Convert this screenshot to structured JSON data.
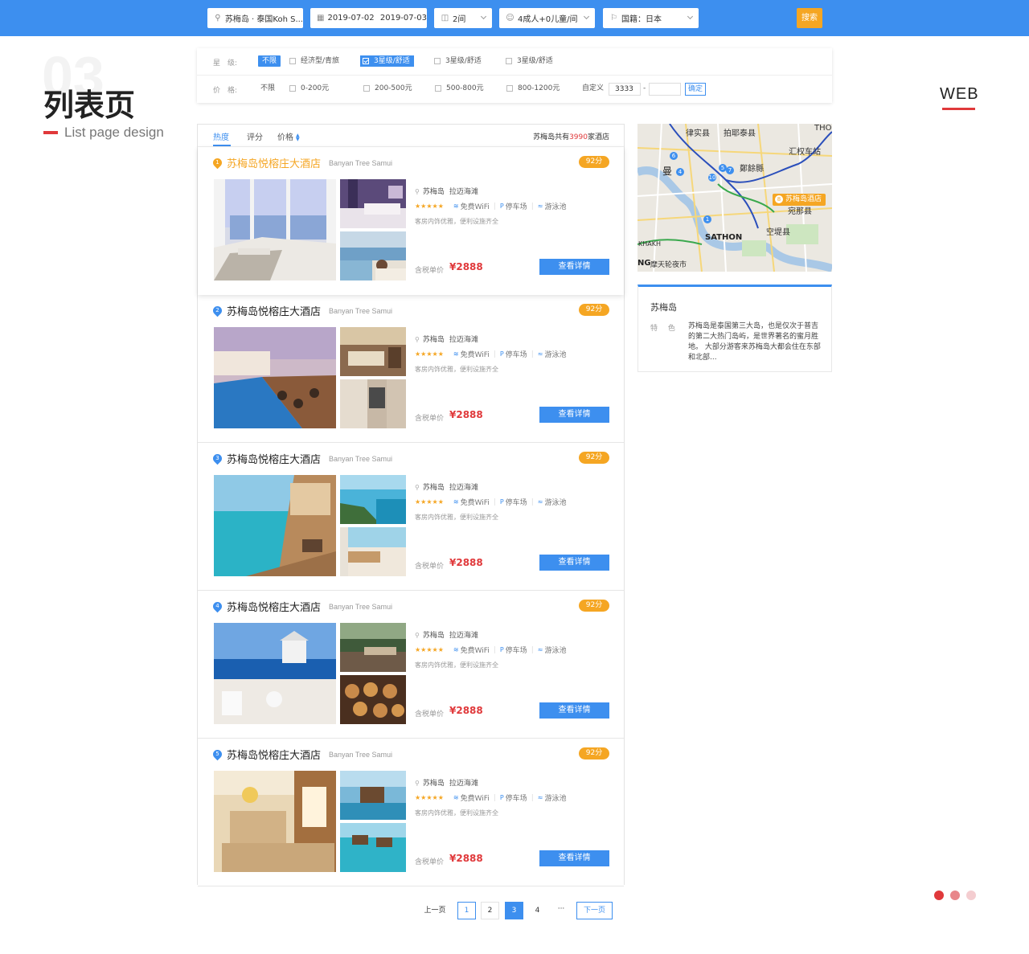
{
  "search": {
    "destination": "苏梅岛 · 泰国Koh S...",
    "checkin": "2019-07-02",
    "checkout": "2019-07-03",
    "rooms": "2间",
    "guests": "4成人+0儿童/间",
    "nationality": "国籍：日本",
    "search_label": "搜索"
  },
  "heading": {
    "number": "03",
    "title": "列表页",
    "subtitle": "List page design",
    "web": "WEB"
  },
  "filters": {
    "star_label": "星　级:",
    "star_options": [
      "不限",
      "经济型/青旅",
      "3星级/舒适",
      "3星级/舒适",
      "3星级/舒适"
    ],
    "price_label": "价　格:",
    "price_options": [
      "不限",
      "0-200元",
      "200-500元",
      "500-800元",
      "800-1200元"
    ],
    "custom_label": "自定义",
    "custom_min": "3333",
    "custom_dash": "-",
    "confirm_label": "确定"
  },
  "sort": {
    "tabs": [
      "热度",
      "评分",
      "价格"
    ],
    "active": 0,
    "total_prefix": "苏梅岛共有",
    "total_count": "3990",
    "total_suffix": "家酒店"
  },
  "hotels": [
    {
      "rank": "1",
      "name": "苏梅岛悦榕庄大酒店",
      "name_en": "Banyan Tree Samui",
      "score": "92分",
      "location": "苏梅岛",
      "area": "拉迈海滩",
      "stars": "★★★★★",
      "wifi": "免费WiFi",
      "parking": "停车场",
      "pool": "游泳池",
      "desc": "客房内饰优雅，便利设施齐全",
      "price_label": "含税单价",
      "price": "¥2888",
      "button": "查看详情"
    },
    {
      "rank": "2",
      "name": "苏梅岛悦榕庄大酒店",
      "name_en": "Banyan Tree Samui",
      "score": "92分",
      "location": "苏梅岛",
      "area": "拉迈海滩",
      "stars": "★★★★★",
      "wifi": "免费WiFi",
      "parking": "停车场",
      "pool": "游泳池",
      "desc": "客房内饰优雅，便利设施齐全",
      "price_label": "含税单价",
      "price": "¥2888",
      "button": "查看详情"
    },
    {
      "rank": "3",
      "name": "苏梅岛悦榕庄大酒店",
      "name_en": "Banyan Tree Samui",
      "score": "92分",
      "location": "苏梅岛",
      "area": "拉迈海滩",
      "stars": "★★★★★",
      "wifi": "免费WiFi",
      "parking": "停车场",
      "pool": "游泳池",
      "desc": "客房内饰优雅，便利设施齐全",
      "price_label": "含税单价",
      "price": "¥2888",
      "button": "查看详情"
    },
    {
      "rank": "4",
      "name": "苏梅岛悦榕庄大酒店",
      "name_en": "Banyan Tree Samui",
      "score": "92分",
      "location": "苏梅岛",
      "area": "拉迈海滩",
      "stars": "★★★★★",
      "wifi": "免费WiFi",
      "parking": "停车场",
      "pool": "游泳池",
      "desc": "客房内饰优雅，便利设施齐全",
      "price_label": "含税单价",
      "price": "¥2888",
      "button": "查看详情"
    },
    {
      "rank": "5",
      "name": "苏梅岛悦榕庄大酒店",
      "name_en": "Banyan Tree Samui",
      "score": "92分",
      "location": "苏梅岛",
      "area": "拉迈海滩",
      "stars": "★★★★★",
      "wifi": "免费WiFi",
      "parking": "停车场",
      "pool": "游泳池",
      "desc": "客房内饰优雅，便利设施齐全",
      "price_label": "含税单价",
      "price": "¥2888",
      "button": "查看详情"
    }
  ],
  "map": {
    "labels": [
      "律实县",
      "拍耶泰县",
      "THO",
      "汇权车站",
      "曼",
      "鄭餘縣",
      "苏梅岛酒店",
      "宛那县",
      "SATHON",
      "空堤县",
      "KHAKH",
      "NG",
      "摩天轮夜市"
    ],
    "markers": [
      "1",
      "4",
      "5",
      "6",
      "7",
      "10",
      "8"
    ]
  },
  "info": {
    "city": "苏梅岛",
    "feature_label": "特 色",
    "feature_text": "苏梅岛是泰国第三大岛，也是仅次于普吉的第二大热门岛屿，是世界著名的蜜月胜地。 大部分游客来苏梅岛大都会住在东部和北部..."
  },
  "pagination": {
    "prev": "上一页",
    "pages": [
      "1",
      "2",
      "3",
      "4"
    ],
    "current": "3",
    "ellipsis": "···",
    "next": "下一页"
  },
  "colors": {
    "primary": "#3d8fef",
    "accent": "#f5a623",
    "price": "#e0393b",
    "dots": [
      "#e0393b",
      "#e8868a",
      "#f4cdd0"
    ]
  }
}
